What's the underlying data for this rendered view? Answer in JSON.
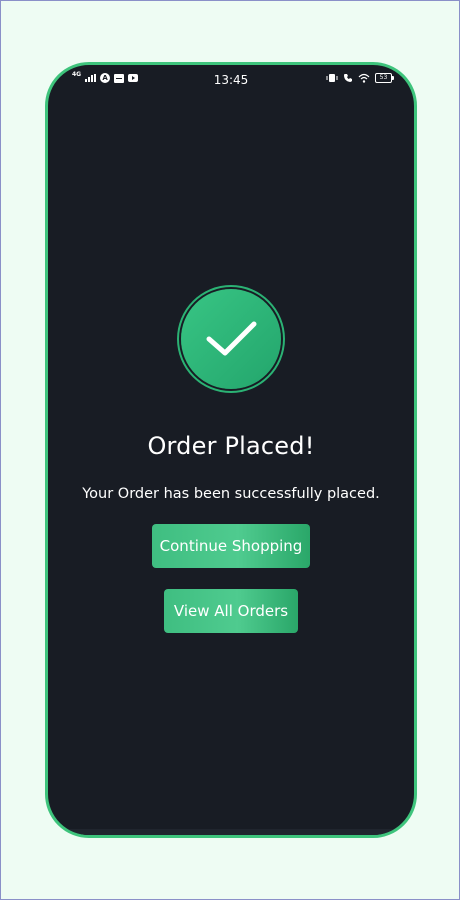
{
  "status_bar": {
    "network": "4G",
    "time": "13:45",
    "battery": "53"
  },
  "colors": {
    "page_background": "#eefcf3",
    "phone_background": "#181c24",
    "accent": "#3ec47c",
    "text": "#ffffff"
  },
  "icons": {
    "success": "check-icon"
  },
  "confirmation": {
    "title": "Order Placed!",
    "message": "Your Order has been successfully placed."
  },
  "actions": {
    "continue_label": "Continue Shopping",
    "orders_label": "View All Orders"
  }
}
